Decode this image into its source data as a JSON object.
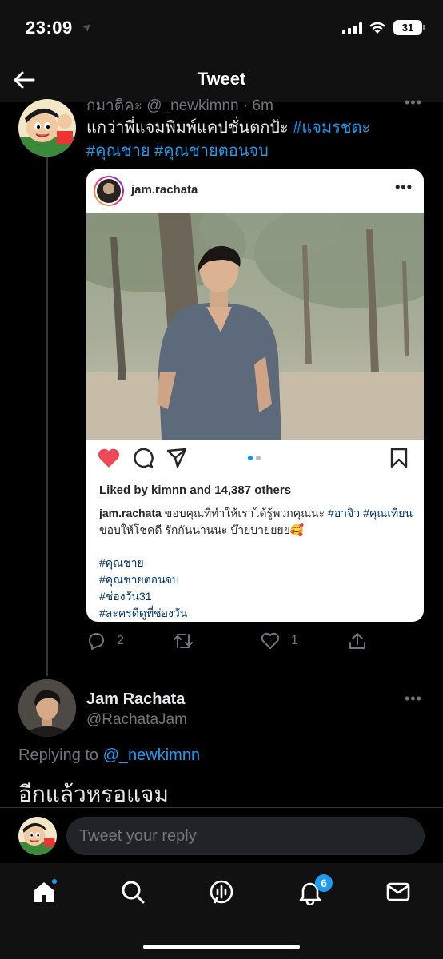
{
  "status_bar": {
    "time": "23:09",
    "battery": "31"
  },
  "header": {
    "title": "Tweet"
  },
  "main_tweet": {
    "meta": "กมาติคะ @_newkimnn · 6m",
    "text_line1": "แกว่าพี่แจมพิมพ์แคปชั่นตกป้ะ",
    "hashtag1": "#แจมรชตะ",
    "hashtag2": "#คุณชาย",
    "hashtag3": "#คุณชายตอนจบ",
    "replies": "2",
    "likes": "1"
  },
  "ig_card": {
    "username": "jam.rachata",
    "likes_text": "Liked by kimnn and 14,387 others",
    "caption_text": "ขอบคุณที่ทำให้เราได้รู้พวกคุณนะ",
    "caption_tag1": "#อาจิว",
    "caption_tag2": "#คุณเทียน",
    "caption_rest": "ขอบให้โชคดี รักกันนานนะ บ๊ายบายยยย🥰",
    "tags": [
      "#คุณชาย",
      "#คุณชายตอนจบ",
      "#ช่องวัน31",
      "#ละครดีดูที่ช่องวัน"
    ]
  },
  "reply_tweet": {
    "name": "Jam Rachata",
    "handle": "@RachataJam",
    "replying_label": "Replying to",
    "replying_handle": "@_newkimnn",
    "text": "อีกแล้วหรอแจม"
  },
  "compose": {
    "placeholder": "Tweet your reply"
  },
  "nav": {
    "notification_count": "6"
  },
  "colors": {
    "accent": "#1d9bf0",
    "background": "#000000",
    "muted": "#71767b",
    "like_red": "#ed4956"
  }
}
